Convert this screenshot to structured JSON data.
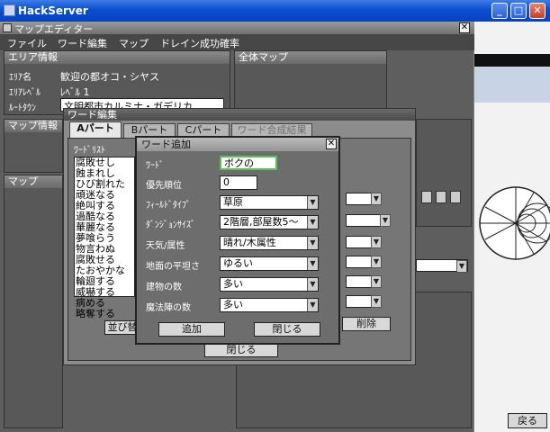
{
  "window": {
    "title": "HackServer"
  },
  "editor": {
    "title": "マップエディター",
    "menu": [
      "ファイル",
      "ワード編集",
      "マップ",
      "ドレイン成功確率"
    ],
    "area_info": {
      "header": "エリア情報",
      "area_name_label": "ｴﾘｱ名",
      "area_name_value": "歓迎の都オコ・シヤス",
      "area_level_label": "ｴﾘｱﾚﾍﾞﾙ",
      "area_level_value": "ﾚﾍﾞﾙ 1",
      "root_town_label": "ﾙｰﾄﾀｳﾝ",
      "root_town_value": "文明都市カルミナ・ガデリカ"
    },
    "whole_map_header": "全体マップ",
    "map_info_header": "マップ情報",
    "map_header": "マップ"
  },
  "word_edit": {
    "title": "ワード編集",
    "tabs": [
      "Aパート",
      "Bパート",
      "Cパート",
      "ワード合成結果"
    ],
    "word_list_label": "ﾜｰﾄﾞﾘｽﾄ",
    "words": [
      "腐敗せし",
      "蝕まれし",
      "ひび割れた",
      "頑迷なる",
      "絶叫する",
      "過酷なる",
      "華麗なる",
      "夢喰らう",
      "物言わぬ",
      "腐敗せる",
      "たおやかな",
      "輪廻する",
      "威嚇する",
      "病める",
      "略奪する"
    ],
    "sort_button": "並び替",
    "delete_button": "削除",
    "close_button": "閉じる"
  },
  "word_add": {
    "title": "ワード追加",
    "word_label": "ﾜｰﾄﾞ",
    "word_value": "ボクの",
    "priority_label": "優先順位",
    "priority_value": "0",
    "field_type_label": "ﾌｨｰﾙﾄﾞﾀｲﾌﾟ",
    "field_type_value": "草原",
    "dungeon_size_label": "ﾀﾞﾝｼﾞｮﾝｻｲｽﾞ",
    "dungeon_size_value": "2階層,部屋数5〜",
    "weather_label": "天気/属性",
    "weather_value": "晴れ/木属性",
    "flatness_label": "地面の平坦さ",
    "flatness_value": "ゆるい",
    "buildings_label": "建物の数",
    "buildings_value": "多い",
    "magic_label": "魔法陣の数",
    "magic_value": "多い",
    "add_button": "追加",
    "close_button": "閉じる"
  },
  "side": {
    "back_button": "戻る"
  }
}
